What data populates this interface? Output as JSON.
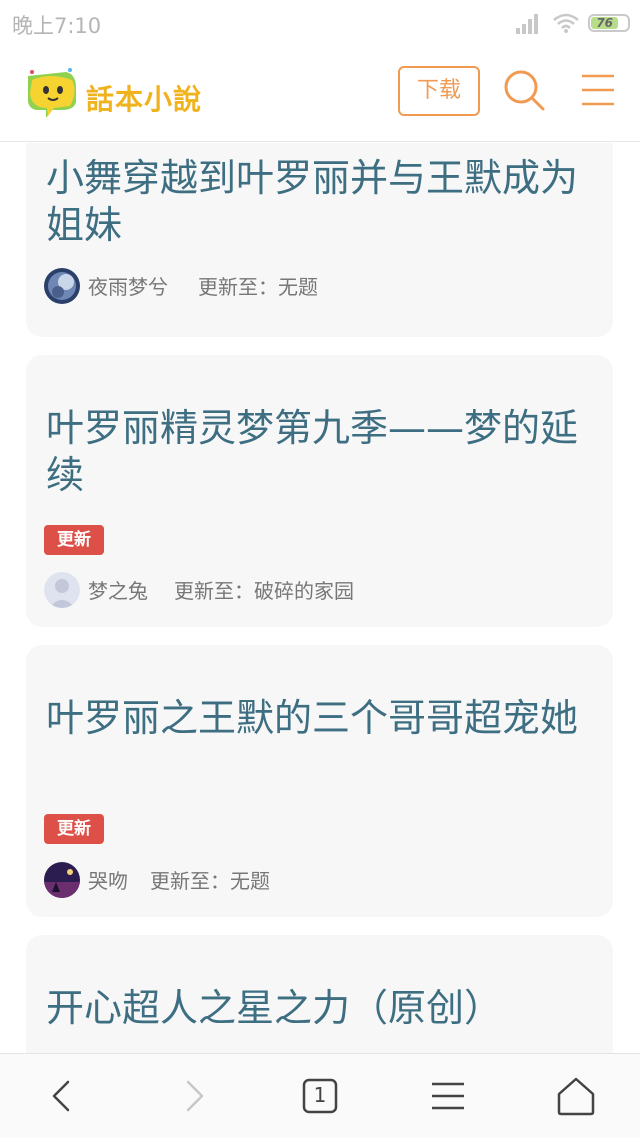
{
  "status_bar": {
    "time": "晚上7:10",
    "battery_level": "76"
  },
  "header": {
    "logo_text": "話本小說",
    "download_label": "下载"
  },
  "stories": [
    {
      "title": "小舞穿越到叶罗丽并与王默成为姐妹",
      "badge": "",
      "author": "夜雨梦兮",
      "update_info": "更新至：无题"
    },
    {
      "title": "叶罗丽精灵梦第九季——梦的延续",
      "badge": "更新",
      "author": "梦之兔",
      "update_info": "更新至：破碎的家园"
    },
    {
      "title": "叶罗丽之王默的三个哥哥超宠她",
      "badge": "更新",
      "author": "哭吻",
      "update_info": "更新至：无题"
    },
    {
      "title": "开心超人之星之力（原创）",
      "badge": "",
      "author": "",
      "update_info": ""
    }
  ],
  "bottom_bar": {
    "tab_count": "1"
  },
  "colors": {
    "accent": "#f09a52",
    "title": "#3d6e82",
    "badge": "#dd5048",
    "card_bg": "#f7f7f7"
  }
}
